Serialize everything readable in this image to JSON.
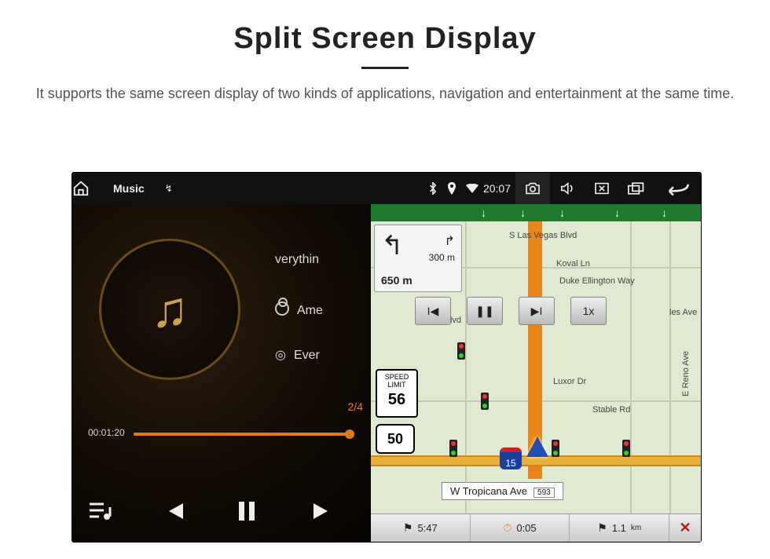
{
  "header": {
    "title": "Split Screen Display",
    "subtitle": "It supports the same screen display of two kinds of applications, navigation and entertainment at the same time."
  },
  "statusbar": {
    "app_label": "Music",
    "usb_label": "↯",
    "time": "20:07"
  },
  "music": {
    "line1": "verythin",
    "line2": "Ame",
    "line3": "Ever",
    "track_index": "2/4",
    "elapsed": "00:01:20"
  },
  "map": {
    "turn": {
      "sub_dist": "300 m",
      "main_dist": "650 m"
    },
    "streets": {
      "s_las_vegas": "S Las Vegas Blvd",
      "koval": "Koval Ln",
      "duke": "Duke Ellington Way",
      "vegas_blvd": "Vegas Blvd",
      "luxor": "Luxor Dr",
      "stable": "Stable Rd",
      "reno": "E Reno Ave",
      "les": "les Ave"
    },
    "overlay_speed": "1x",
    "speed_limit_label": "SPEED LIMIT",
    "speed_limit": "56",
    "hwy": "50",
    "interstate": "15",
    "current_street": "W Tropicana Ave",
    "current_badge": "593",
    "bottombar": {
      "eta": "5:47",
      "duration": "0:05",
      "distance": "1.1",
      "distance_unit": "km"
    }
  }
}
